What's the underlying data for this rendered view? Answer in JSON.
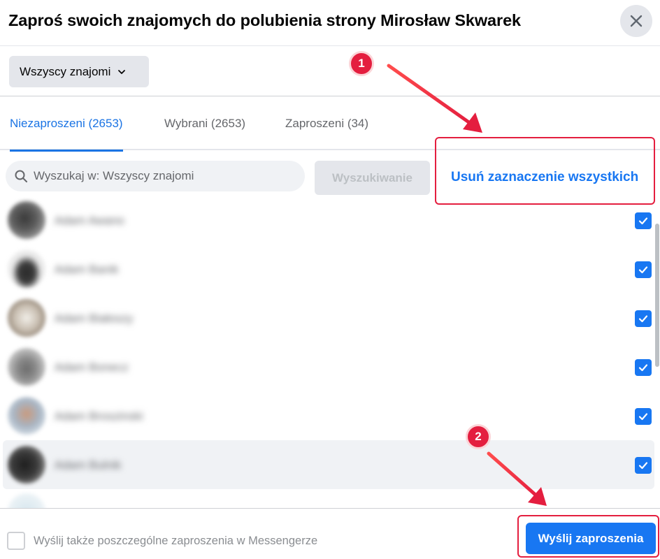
{
  "dialog": {
    "title": "Zaproś swoich znajomych do polubienia strony Mirosław Skwarek",
    "close_icon": "close-icon"
  },
  "filter": {
    "selected": "Wszyscy znajomi",
    "icon": "chevron-down-icon"
  },
  "tabs": [
    {
      "label": "Niezaproszeni (2653)",
      "active": true
    },
    {
      "label": "Wybrani (2653)",
      "active": false
    },
    {
      "label": "Zaproszeni (34)",
      "active": false
    }
  ],
  "search": {
    "placeholder": "Wyszukaj w: Wszyscy znajomi",
    "button_label": "Wyszukiwanie",
    "icon": "search-icon"
  },
  "deselect_all_label": "Usuń zaznaczenie wszystkich",
  "friends": [
    {
      "name": "Adam Awano",
      "checked": true
    },
    {
      "name": "Adam Banik",
      "checked": true
    },
    {
      "name": "Adam Białoszy",
      "checked": true
    },
    {
      "name": "Adam Bonecz",
      "checked": true
    },
    {
      "name": "Adam Broszinski",
      "checked": true
    },
    {
      "name": "Adam Bulnik",
      "checked": true
    }
  ],
  "footer": {
    "messenger_label": "Wyślij także poszczególne zaproszenia w Messengerze",
    "messenger_checked": false,
    "send_label": "Wyślij zaproszenia"
  },
  "annotations": [
    {
      "number": "1"
    },
    {
      "number": "2"
    }
  ],
  "colors": {
    "accent": "#1877f2",
    "annotation_red": "#e41e3f"
  }
}
